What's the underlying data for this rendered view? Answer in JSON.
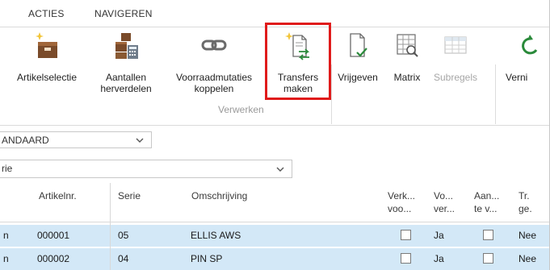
{
  "menu": {
    "tabs": [
      "ACTIES",
      "NAVIGEREN"
    ]
  },
  "ribbon": {
    "buttons": [
      {
        "label_line1": "Artikelselectie",
        "label_line2": "",
        "icon": "box-sparkle-icon",
        "enabled": true
      },
      {
        "label_line1": "Aantallen",
        "label_line2": "herverdelen",
        "icon": "boxes-calculator-icon",
        "enabled": true
      },
      {
        "label_line1": "Voorraadmutaties",
        "label_line2": "koppelen",
        "icon": "chain-link-icon",
        "enabled": true
      },
      {
        "label_line1": "Transfers",
        "label_line2": "maken",
        "icon": "document-transfer-icon",
        "enabled": true,
        "highlighted": true
      },
      {
        "label_line1": "Vrijgeven",
        "label_line2": "",
        "icon": "document-check-icon",
        "enabled": true
      },
      {
        "label_line1": "Matrix",
        "label_line2": "",
        "icon": "grid-magnifier-icon",
        "enabled": true
      },
      {
        "label_line1": "Subregels",
        "label_line2": "",
        "icon": "grid-icon",
        "enabled": false
      },
      {
        "label_line1": "Verni",
        "label_line2": "",
        "icon": "refresh-icon",
        "enabled": true
      }
    ],
    "group_label": "Verwerken"
  },
  "filters": {
    "view": "ANDAARD",
    "field": "rie"
  },
  "table": {
    "headers": {
      "artikelnr": "Artikelnr.",
      "serie": "Serie",
      "omschrijving": "Omschrijving",
      "verk_line1": "Verk...",
      "verk_line2": "voo...",
      "vo_line1": "Vo...",
      "vo_line2": "ver...",
      "aan_line1": "Aan...",
      "aan_line2": "te v...",
      "tr_line1": "Tr.",
      "tr_line2": "ge."
    },
    "rows": [
      {
        "lead": "n",
        "artikelnr": "000001",
        "serie": "05",
        "omschrijving": "ELLIS AWS",
        "verk": false,
        "vo": "Ja",
        "aan": false,
        "tr": "Nee"
      },
      {
        "lead": "n",
        "artikelnr": "000002",
        "serie": "04",
        "omschrijving": "PIN SP",
        "verk": false,
        "vo": "Ja",
        "aan": false,
        "tr": "Nee"
      }
    ]
  },
  "colors": {
    "highlight": "#e01b1b",
    "row_selected": "#d3e8f7",
    "icon_accent": "#2a8a3a"
  }
}
